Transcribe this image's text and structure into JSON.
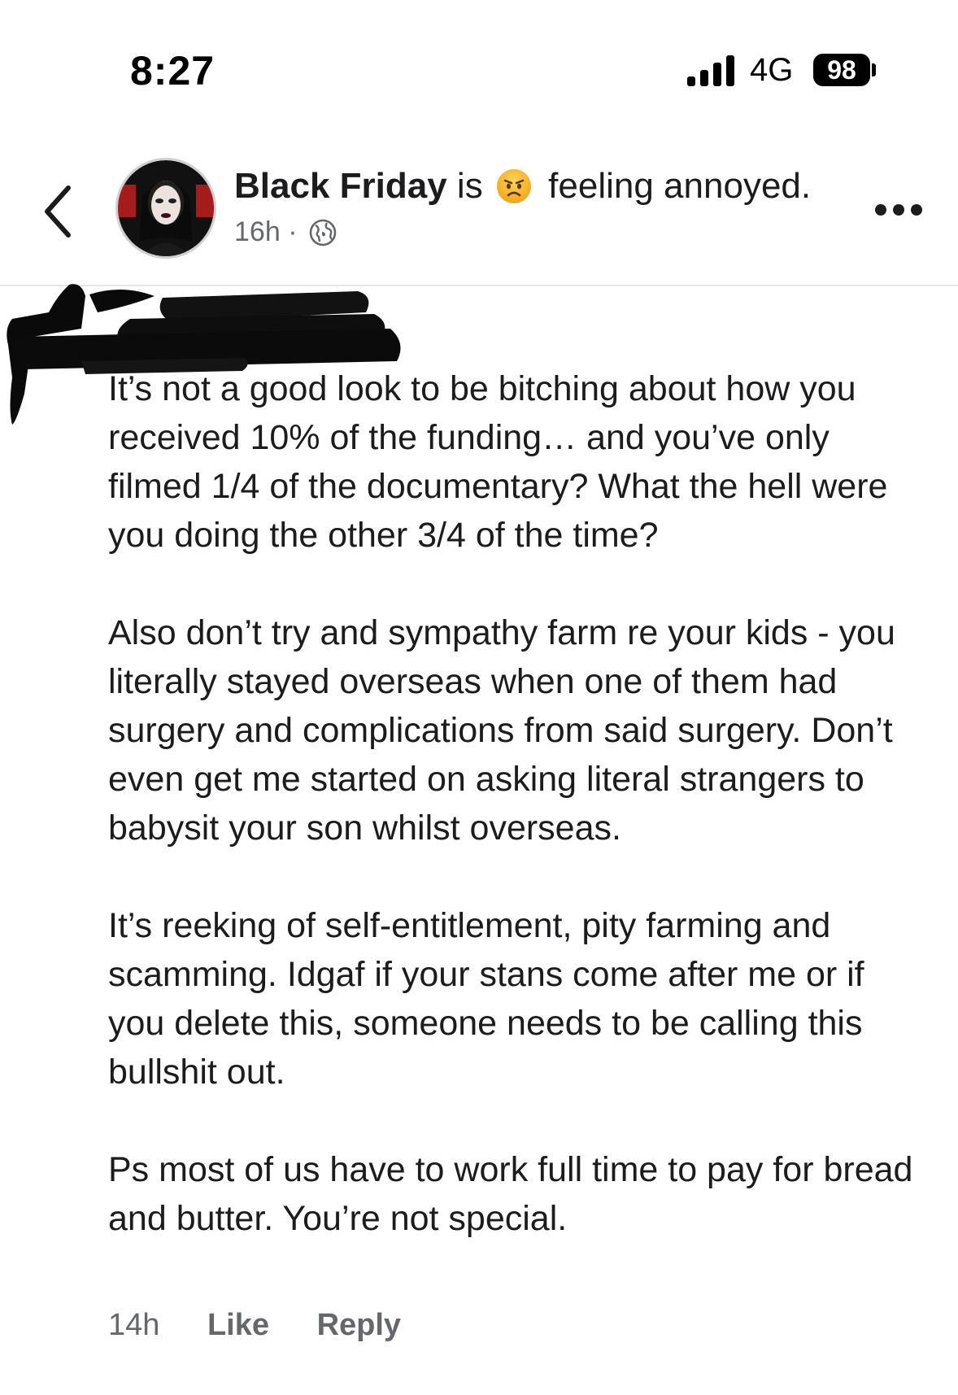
{
  "status_bar": {
    "time": "8:27",
    "network": "4G",
    "battery": "98"
  },
  "post": {
    "author": "Black Friday",
    "verb": "is",
    "feeling": "feeling annoyed.",
    "feeling_emoji": "annoyed-face-icon",
    "time": "16h",
    "separator": "·",
    "audience_icon": "globe-icon"
  },
  "comment": {
    "paragraphs": [
      "It’s not a good look to be bitching about how you received 10% of the funding… and you’ve only filmed 1/4 of the documentary? What the hell were you doing the other 3/4 of the time?",
      "Also don’t try and sympathy farm re your kids - you literally stayed overseas when one of them had surgery and complications from said surgery. Don’t even get me started on asking literal strangers to babysit your son whilst overseas.",
      "It’s reeking of self-entitlement, pity farming and scamming. Idgaf if your stans come after me or if you delete this, someone needs to be calling this bullshit out.",
      "Ps most of us have to work full time to pay for bread and butter. You’re not special."
    ],
    "time": "14h",
    "like_label": "Like",
    "reply_label": "Reply"
  },
  "colors": {
    "text": "#1c1c1e",
    "meta": "#65676b",
    "divider": "#e4e6eb"
  }
}
